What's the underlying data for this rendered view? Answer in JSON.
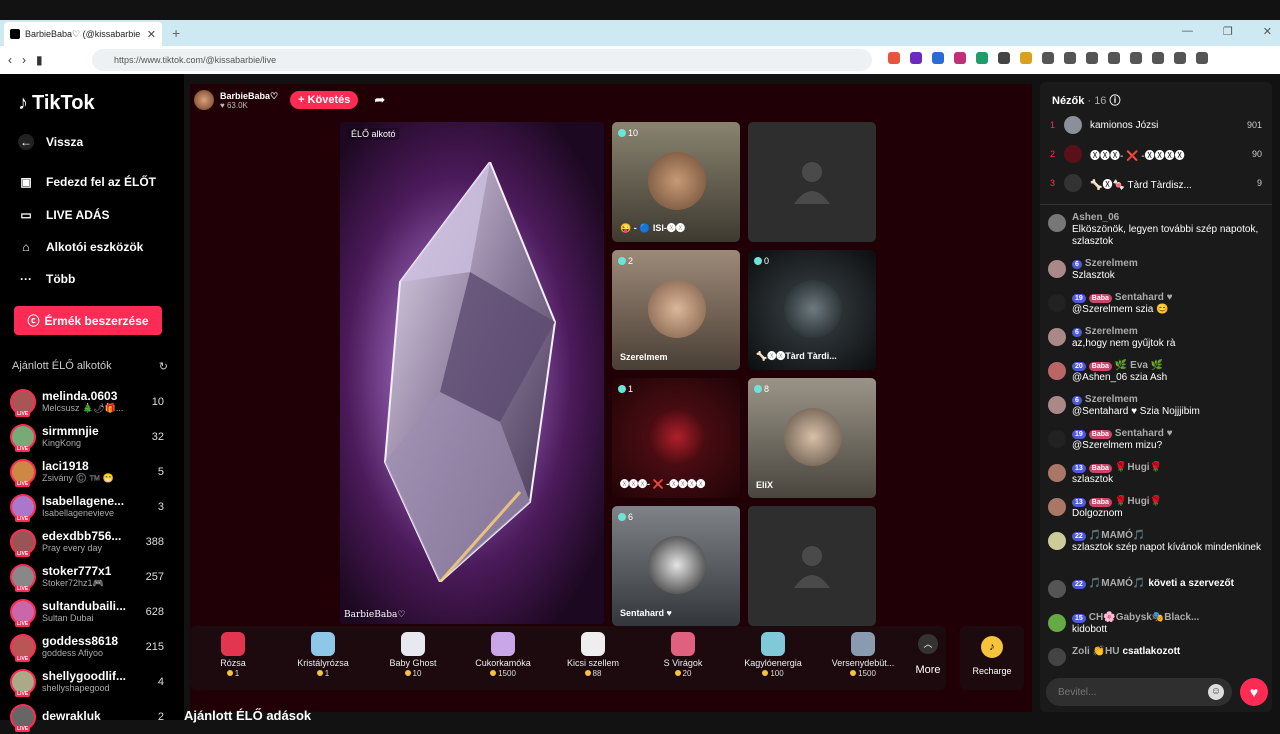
{
  "browser": {
    "tab_title": "BarbieBaba♡ (@kissabarbie",
    "url": "https://www.tiktok.com/@kissabarbie/live",
    "new_tab": "+"
  },
  "sidebar": {
    "logo": "TikTok",
    "back": "Vissza",
    "items": [
      {
        "label": "Fedezd fel az ÉLŐT",
        "icon": "explore-icon"
      },
      {
        "label": "LIVE ADÁS",
        "icon": "camera-icon"
      },
      {
        "label": "Alkotói eszközök",
        "icon": "tools-icon"
      },
      {
        "label": "Több",
        "icon": "more-icon"
      }
    ],
    "coins_button": "Érmék beszerzése",
    "recommended_title": "Ajánlott ÉLŐ alkotók",
    "live_tag": "LIVE",
    "recommended": [
      {
        "name": "melinda.0603",
        "sub": "Melcsusz 🎄🌶🎁...",
        "count": "10"
      },
      {
        "name": "sirmmnjie",
        "sub": "KingKong",
        "count": "32"
      },
      {
        "name": "laci1918",
        "sub": "Zsivány ©️ ™️ 😁",
        "count": "5"
      },
      {
        "name": "Isabellagene...",
        "sub": "Isabellagenevieve",
        "count": "3"
      },
      {
        "name": "edexdbb756...",
        "sub": "Pray every day",
        "count": "388"
      },
      {
        "name": "stoker777x1",
        "sub": "Stoker72hz1🎮",
        "count": "257"
      },
      {
        "name": "sultandubaili...",
        "sub": "Sultan Dubai",
        "count": "628"
      },
      {
        "name": "goddess8618",
        "sub": "goddess Afiyoo",
        "count": "215"
      },
      {
        "name": "shellygoodlif...",
        "sub": "shellyshapegood",
        "count": "4"
      },
      {
        "name": "dewrakluk",
        "sub": "",
        "count": "2"
      }
    ]
  },
  "host": {
    "name": "BarbieBaba♡",
    "likes": "♥ 63.0K",
    "follow": "+ Követés"
  },
  "stage": {
    "label": "ÉLŐ alkotó",
    "owner": "BarbieBaba♡"
  },
  "guests": [
    {
      "count": "10",
      "name": "😜 - 🔵 ISI-🅧🅧"
    },
    {
      "count": "",
      "name": ""
    },
    {
      "count": "2",
      "name": "Szerelmem"
    },
    {
      "count": "0",
      "name": "🦴🅧🅧Tàrd Tàrdi..."
    },
    {
      "count": "1",
      "name": "🅧🅧🅧- ❌ -🅧🅧🅧🅧"
    },
    {
      "count": "8",
      "name": "EliX"
    },
    {
      "count": "6",
      "name": "Sentahard ♥"
    },
    {
      "count": "",
      "name": ""
    }
  ],
  "gifts": [
    {
      "name": "Rózsa",
      "price": "1",
      "color": "#e2354f"
    },
    {
      "name": "Kristályrózsa",
      "price": "1",
      "color": "#8fc7e8"
    },
    {
      "name": "Baby Ghost",
      "price": "10",
      "color": "#e8e8f0"
    },
    {
      "name": "Cukorkamóka",
      "price": "1500",
      "color": "#c9a6e8"
    },
    {
      "name": "Kicsi szellem",
      "price": "88",
      "color": "#eee"
    },
    {
      "name": "S Virágok",
      "price": "20",
      "color": "#e06080"
    },
    {
      "name": "Kagylóenergia",
      "price": "100",
      "color": "#7fc9d9"
    },
    {
      "name": "Versenydebüt...",
      "price": "1500",
      "color": "#8a9ab0"
    }
  ],
  "more_label": "More",
  "recharge_label": "Recharge",
  "bottom_heading": "Ajánlott ÉLŐ adások",
  "chat": {
    "viewers_title": "Nézők",
    "viewers_count": "· 16",
    "viewers": [
      {
        "rank": "1",
        "name": "kamionos Józsi",
        "points": "901"
      },
      {
        "rank": "2",
        "name": "🅧🅧🅧- ❌ -🅧🅧🅧🅧",
        "points": "90"
      },
      {
        "rank": "3",
        "name": "🦴🅧🍬 Tàrd Tàrdisz...",
        "points": "9"
      }
    ],
    "messages": [
      {
        "user": "Ashen_06",
        "level": "",
        "fan": "",
        "text": "Elköszönök, legyen további szép napotok, szlasztok"
      },
      {
        "user": "Szerelmem",
        "level": "6",
        "fan": "",
        "text": "Szlasztok"
      },
      {
        "user": "Sentahard ♥",
        "level": "19",
        "fan": "Baba",
        "text": "@Szerelmem szia 😊"
      },
      {
        "user": "Szerelmem",
        "level": "6",
        "fan": "",
        "text": "az,hogy nem gyűjtok rà"
      },
      {
        "user": "🌿 Eva 🌿",
        "level": "20",
        "fan": "Baba",
        "text": "@Ashen_06 szia Ash"
      },
      {
        "user": "Szerelmem",
        "level": "6",
        "fan": "",
        "text": "@Sentahard ♥ Szia Nojjjibim"
      },
      {
        "user": "Sentahard ♥",
        "level": "19",
        "fan": "Baba",
        "text": "@Szerelmem mizu?"
      },
      {
        "user": "🌹Hugi🌹",
        "level": "13",
        "fan": "Baba",
        "text": "szlasztok"
      },
      {
        "user": "🌹Hugi🌹",
        "level": "13",
        "fan": "Baba",
        "text": "Dolgoznom"
      },
      {
        "user": "🎵MAMÓ🎵",
        "level": "22",
        "fan": "",
        "text": "szlasztok szép napot kívánok mindenkinek"
      },
      {
        "user": "🎵MAMÓ🎵",
        "level": "22",
        "fan": "",
        "text": "követi a szervezőt"
      },
      {
        "user": "CH🌸Gabysk🎭Black...",
        "level": "15",
        "fan": "",
        "text": "kidobott"
      },
      {
        "user": "Zoli 👏HU",
        "level": "",
        "fan": "",
        "text": "csatlakozott"
      }
    ],
    "input_placeholder": "Bevitel..."
  }
}
